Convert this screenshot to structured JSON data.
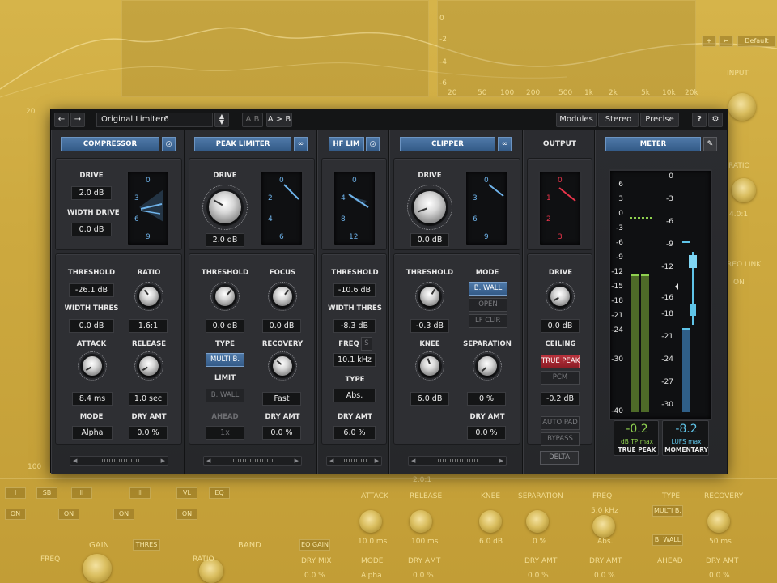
{
  "background": {
    "top_left_value": "20",
    "bottom_left_value": "100",
    "freq_axis": [
      "20",
      "50",
      "100",
      "200",
      "500",
      "1k",
      "2k",
      "5k",
      "10k",
      "20k"
    ],
    "db_scale_right": [
      "0",
      "-2",
      "-4",
      "-6"
    ],
    "right_preset": "Default",
    "right_labels": [
      "INPUT",
      "RATIO",
      "4.0:1",
      "REO LINK",
      "ON"
    ],
    "bottom_row_labels": [
      "ATTACK",
      "RELEASE",
      "KNEE",
      "SEPARATION",
      "FREQ",
      "TYPE",
      "RECOVERY"
    ],
    "bottom_row_values": [
      "2.0:1",
      "5.0 kHz",
      "MULTI B.",
      "B. WALL"
    ],
    "bottom_value_row": [
      "10.0 ms",
      "100 ms",
      "6.0 dB",
      "0 %",
      "Abs.",
      "50 ms"
    ],
    "bottom_labels2": [
      "GAIN",
      "THRES",
      "BAND I",
      "EQ GAIN",
      "DRY MIX",
      "MODE",
      "DRY AMT",
      "DRY AMT",
      "DRY AMT",
      "AHEAD",
      "DRY AMT"
    ],
    "bottom_values2": [
      "Alpha",
      "0.0 %",
      "0.0 %",
      "0.0 %",
      "0.0 %",
      "0.0 %"
    ],
    "bottom_small": [
      "FREQ",
      "RATIO",
      "ON",
      "ON",
      "ON",
      "ON",
      "VL",
      "III",
      "II",
      "I",
      "SB",
      "EQ"
    ]
  },
  "topbar": {
    "back_icon": "arrow-left-icon",
    "forward_icon": "arrow-right-icon",
    "preset_name": "Original Limiter6",
    "ab_label": "A B",
    "copy_ab_label": "A > B",
    "modules_label": "Modules",
    "stereo_label": "Stereo",
    "precise_label": "Precise",
    "help_label": "?",
    "settings_icon": "gear-icon"
  },
  "compressor": {
    "title": "COMPRESSOR",
    "drive_label": "DRIVE",
    "drive_value": "2.0 dB",
    "width_drive_label": "WIDTH DRIVE",
    "width_drive_value": "0.0 dB",
    "gauge_ticks": [
      "0",
      "3",
      "6",
      "9"
    ],
    "threshold_label": "THRESHOLD",
    "threshold_value": "-26.1 dB",
    "ratio_label": "RATIO",
    "ratio_value": "1.6:1",
    "width_thres_label": "WIDTH THRES",
    "width_thres_value": "0.0 dB",
    "attack_label": "ATTACK",
    "attack_value": "8.4 ms",
    "release_label": "RELEASE",
    "release_value": "1.0 sec",
    "mode_label": "MODE",
    "mode_value": "Alpha",
    "dry_amt_label": "DRY AMT",
    "dry_amt_value": "0.0 %"
  },
  "peak_limiter": {
    "title": "PEAK LIMITER",
    "drive_label": "DRIVE",
    "drive_value": "2.0 dB",
    "gauge_ticks": [
      "0",
      "2",
      "4",
      "6"
    ],
    "threshold_label": "THRESHOLD",
    "threshold_value": "0.0 dB",
    "focus_label": "FOCUS",
    "focus_value": "0.0 dB",
    "type_label": "TYPE",
    "type_value": "MULTI B.",
    "recovery_label": "RECOVERY",
    "recovery_value": "Fast",
    "limit_label": "LIMIT",
    "limit_value": "B. WALL",
    "ahead_label": "AHEAD",
    "ahead_value": "1x",
    "dry_amt_label": "DRY AMT",
    "dry_amt_value": "0.0 %"
  },
  "hf_lim": {
    "title": "HF LIM",
    "gauge_ticks": [
      "0",
      "4",
      "8",
      "12"
    ],
    "threshold_label": "THRESHOLD",
    "threshold_value": "-10.6 dB",
    "width_thres_label": "WIDTH THRES",
    "width_thres_value": "-8.3 dB",
    "freq_label": "FREQ",
    "freq_s": "S",
    "freq_value": "10.1 kHz",
    "type_label": "TYPE",
    "type_value": "Abs.",
    "dry_amt_label": "DRY AMT",
    "dry_amt_value": "6.0 %"
  },
  "clipper": {
    "title": "CLIPPER",
    "drive_label": "DRIVE",
    "drive_value": "0.0 dB",
    "gauge_ticks": [
      "0",
      "3",
      "6",
      "9"
    ],
    "threshold_label": "THRESHOLD",
    "threshold_value": "-0.3 dB",
    "mode_label": "MODE",
    "mode_options": [
      "B. WALL",
      "OPEN",
      "LF CLIP."
    ],
    "knee_label": "KNEE",
    "knee_value": "6.0 dB",
    "separation_label": "SEPARATION",
    "separation_value": "0 %",
    "dry_amt_label": "DRY AMT",
    "dry_amt_value": "0.0 %"
  },
  "output": {
    "title": "OUTPUT",
    "gauge_ticks": [
      "0",
      "1",
      "2",
      "3"
    ],
    "drive_label": "DRIVE",
    "drive_value": "0.0 dB",
    "ceiling_label": "CEILING",
    "true_peak_label": "TRUE PEAK",
    "pcm_label": "PCM",
    "ceiling_value": "-0.2 dB",
    "auto_pad_label": "AUTO PAD",
    "bypass_label": "BYPASS",
    "delta_label": "DELTA"
  },
  "meter": {
    "title": "METER",
    "left_scale": [
      "6",
      "3",
      "0",
      "-3",
      "-6",
      "-9",
      "-12",
      "-15",
      "-18",
      "-21",
      "-24",
      "-30",
      "-40"
    ],
    "right_scale": [
      "0",
      "-3",
      "-6",
      "-9",
      "-12",
      "-16",
      "-18",
      "-21",
      "-24",
      "-27",
      "-30"
    ],
    "true_peak_value": "-0.2",
    "true_peak_unit": "dB TP max",
    "true_peak_label": "TRUE PEAK",
    "lufs_value": "-8.2",
    "lufs_unit": "LUFS max",
    "lufs_label": "MOMENTARY",
    "colors": {
      "green": "#8fd14f",
      "cyan": "#5fc4e8",
      "blue_accent": "#345b88"
    }
  }
}
